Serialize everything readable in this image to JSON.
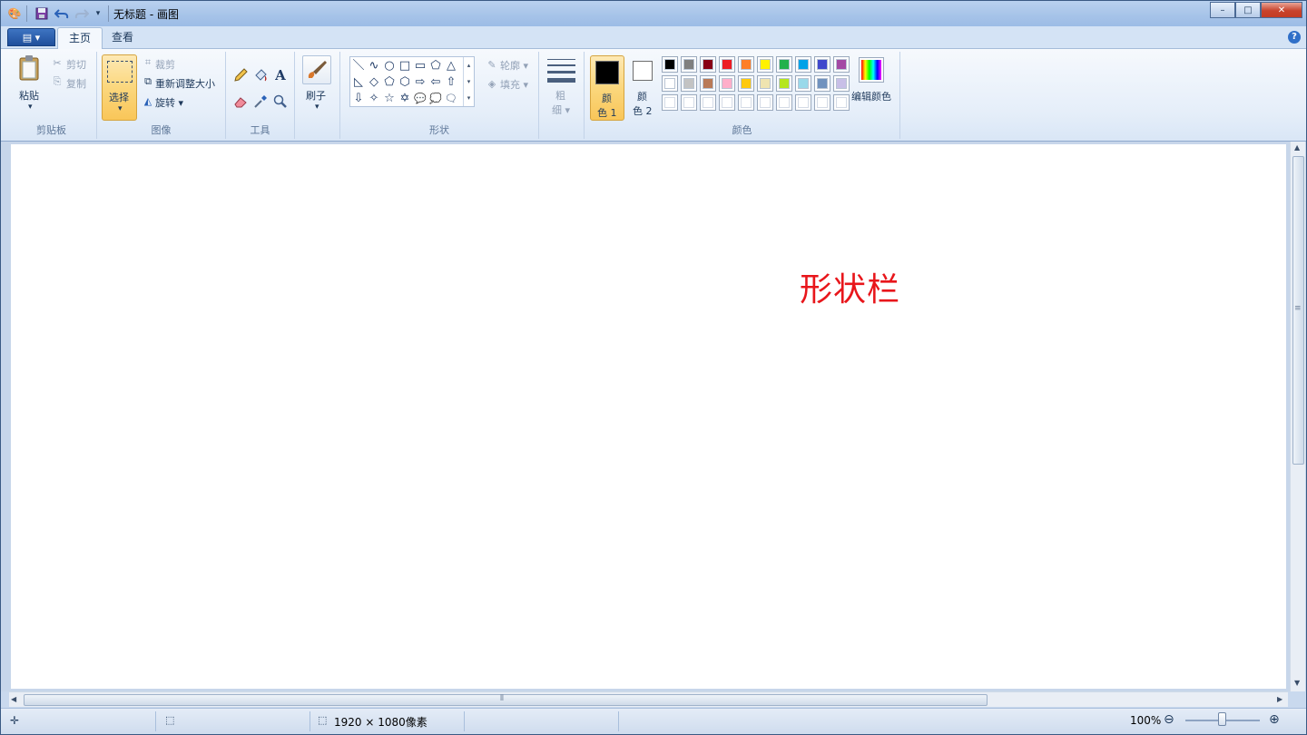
{
  "titlebar": {
    "title": "无标题 - 画图",
    "minimize": "–",
    "maximize": "□",
    "close": "✕"
  },
  "tabs": {
    "file_menu": "▤ ▾",
    "home": "主页",
    "view": "查看",
    "help": "?"
  },
  "clipboard": {
    "paste": "粘贴",
    "cut": "剪切",
    "copy": "复制",
    "group": "剪贴板"
  },
  "image": {
    "select": "选择",
    "crop": "裁剪",
    "resize": "重新调整大小",
    "rotate": "旋转 ▾",
    "group": "图像"
  },
  "tools": {
    "group": "工具"
  },
  "brushes": {
    "label": "刷子"
  },
  "shapes": {
    "outline": "轮廓 ▾",
    "fill": "填充 ▾",
    "group": "形状",
    "icons": [
      "＼",
      "∿",
      "○",
      "□",
      "▭",
      "⬠",
      "△",
      "◺",
      "◇",
      "⬠",
      "⬡",
      "⇨",
      "⇦",
      "⇧",
      "⇩",
      "✧",
      "☆",
      "✡",
      "💬",
      "💭",
      "🗨"
    ]
  },
  "size": {
    "line1": "粗",
    "line2": "细 ▾"
  },
  "colors": {
    "color1_l1": "颜",
    "color1_l2": "色 1",
    "color2_l1": "颜",
    "color2_l2": "色 2",
    "edit_colors": "编辑颜色",
    "group": "颜色",
    "row1": [
      "#000000",
      "#7f7f7f",
      "#880015",
      "#ed1c24",
      "#ff7f27",
      "#fff200",
      "#22b14c",
      "#00a2e8",
      "#3f48cc",
      "#a349a4"
    ],
    "row2": [
      "#ffffff",
      "#c3c3c3",
      "#b97a57",
      "#ffaec9",
      "#ffc90e",
      "#efe4b0",
      "#b5e61d",
      "#99d9ea",
      "#7092be",
      "#c8bfe7"
    ],
    "row3": [
      "#ffffff",
      "#ffffff",
      "#ffffff",
      "#ffffff",
      "#ffffff",
      "#ffffff",
      "#ffffff",
      "#ffffff",
      "#ffffff",
      "#ffffff"
    ],
    "selected1": "#000000",
    "selected2": "#ffffff"
  },
  "canvas": {
    "annotation": "形状栏"
  },
  "statusbar": {
    "cursor_icon": "✛",
    "selection_icon": "⬚",
    "size_icon": "⬚",
    "image_size": "1920 × 1080像素",
    "zoom": "100%",
    "zoom_out": "⊖",
    "zoom_in": "⊕"
  },
  "scroll": {
    "up": "▲",
    "down": "▼",
    "left": "◀",
    "right": "▶",
    "grip_v": "≡",
    "grip_h": "⦀"
  }
}
